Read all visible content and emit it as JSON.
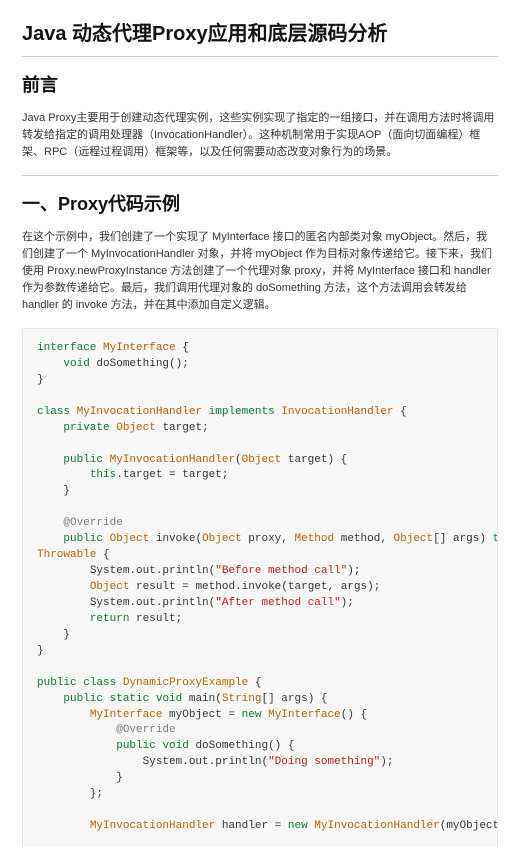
{
  "title": "Java 动态代理Proxy应用和底层源码分析",
  "section1": {
    "heading": "前言",
    "para": "Java Proxy主要用于创建动态代理实例，这些实例实现了指定的一组接口，并在调用方法时将调用转发给指定的调用处理器（InvocationHandler）。这种机制常用于实现AOP（面向切面编程）框架、RPC（远程过程调用）框架等，以及任何需要动态改变对象行为的场景。"
  },
  "section2": {
    "heading": "一、Proxy代码示例",
    "para": "在这个示例中，我们创建了一个实现了 MyInterface 接口的匿名内部类对象 myObject。然后，我们创建了一个 MyInvocationHandler 对象，并将 myObject 作为目标对象传递给它。接下来，我们使用 Proxy.newProxyInstance 方法创建了一个代理对象 proxy，并将 MyInterface 接口和 handler 作为参数传递给它。最后，我们调用代理对象的 doSomething 方法，这个方法调用会转发给 handler 的 invoke 方法，并在其中添加自定义逻辑。"
  },
  "code": {
    "kw": {
      "interface": "interface",
      "class": "class",
      "void": "void",
      "public": "public",
      "private": "private",
      "return": "return",
      "new": "new",
      "implements": "implements",
      "throws": "throws",
      "this": "this",
      "static": "static"
    },
    "type": {
      "MyInterface": "MyInterface",
      "MyInvocationHandler": "MyInvocationHandler",
      "InvocationHandler": "InvocationHandler",
      "Object": "Object",
      "Method": "Method",
      "Throwable": "Throwable",
      "DynamicProxyExample": "DynamicProxyExample",
      "String": "String"
    },
    "ann": {
      "override": "@Override"
    },
    "id": {
      "doSomething": "doSomething",
      "target": "target",
      "invoke": "invoke",
      "proxy": "proxy",
      "method": "method",
      "args": "args",
      "result": "result",
      "main": "main",
      "myObject": "myObject",
      "handler": "handler",
      "SystemOutPrintln": "System.out.println"
    },
    "str": {
      "before": "\"Before method call\"",
      "after": "\"After method call\"",
      "doing": "\"Doing something\""
    }
  }
}
